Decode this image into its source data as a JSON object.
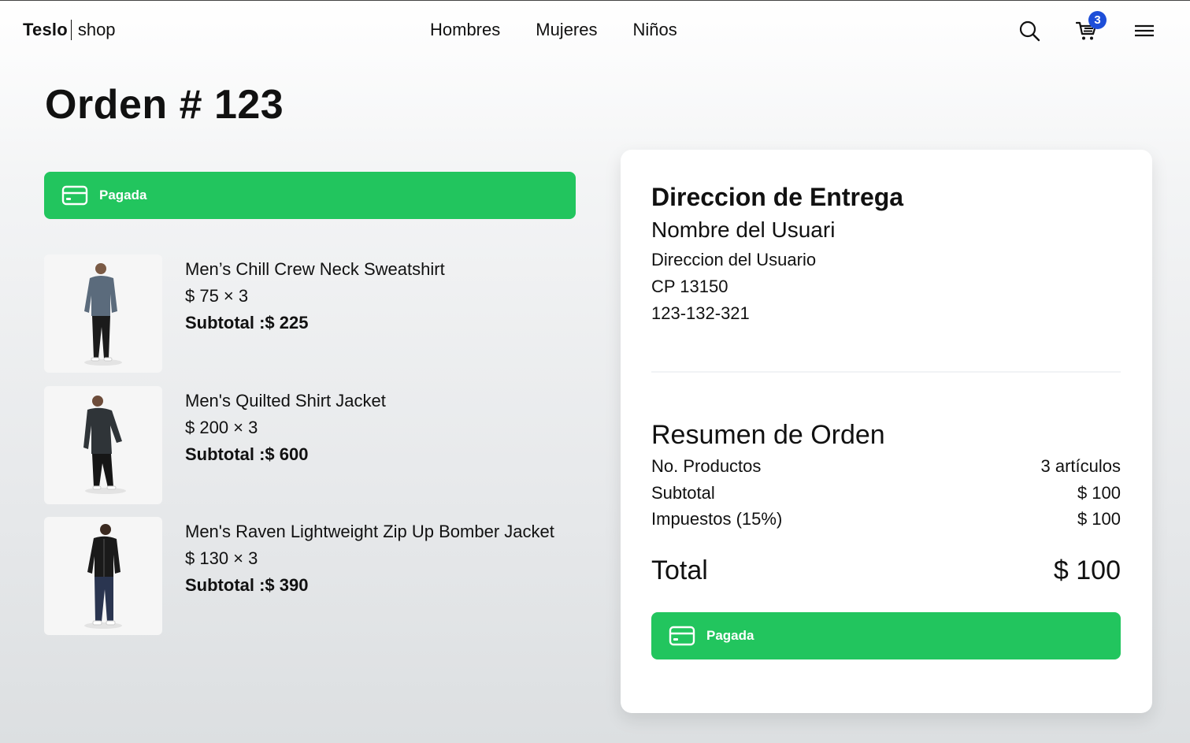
{
  "nav": {
    "logo_bold": "Teslo",
    "logo_light": "shop",
    "links": [
      "Hombres",
      "Mujeres",
      "Niños"
    ],
    "cart_count": "3"
  },
  "page": {
    "title": "Orden # 123"
  },
  "status": {
    "label": "Pagada",
    "color": "#22c55e"
  },
  "items": [
    {
      "name": "Men’s Chill Crew Neck Sweatshirt",
      "price_qty": "$ 75 × 3",
      "subtotal": "Subtotal :$ 225",
      "shirt_color": "#5b6b7c",
      "pants_color": "#1b1b1b"
    },
    {
      "name": "Men's Quilted Shirt Jacket",
      "price_qty": "$ 200 × 3",
      "subtotal": "Subtotal :$ 600",
      "shirt_color": "#2f3438",
      "pants_color": "#161616"
    },
    {
      "name": "Men's Raven Lightweight Zip Up Bomber Jacket",
      "price_qty": "$ 130 × 3",
      "subtotal": "Subtotal :$ 390",
      "shirt_color": "#1a1a1a",
      "pants_color": "#2a3550"
    }
  ],
  "address": {
    "title": "Direccion de Entrega",
    "name": "Nombre del Usuari",
    "street": "Direccion del Usuario",
    "zip": "CP 13150",
    "phone": "123-132-321"
  },
  "summary": {
    "title": "Resumen de Orden",
    "rows": [
      {
        "label": "No. Productos",
        "value": "3 artículos"
      },
      {
        "label": "Subtotal",
        "value": "$ 100"
      },
      {
        "label": "Impuestos (15%)",
        "value": "$ 100"
      }
    ],
    "total_label": "Total",
    "total_value": "$ 100"
  }
}
